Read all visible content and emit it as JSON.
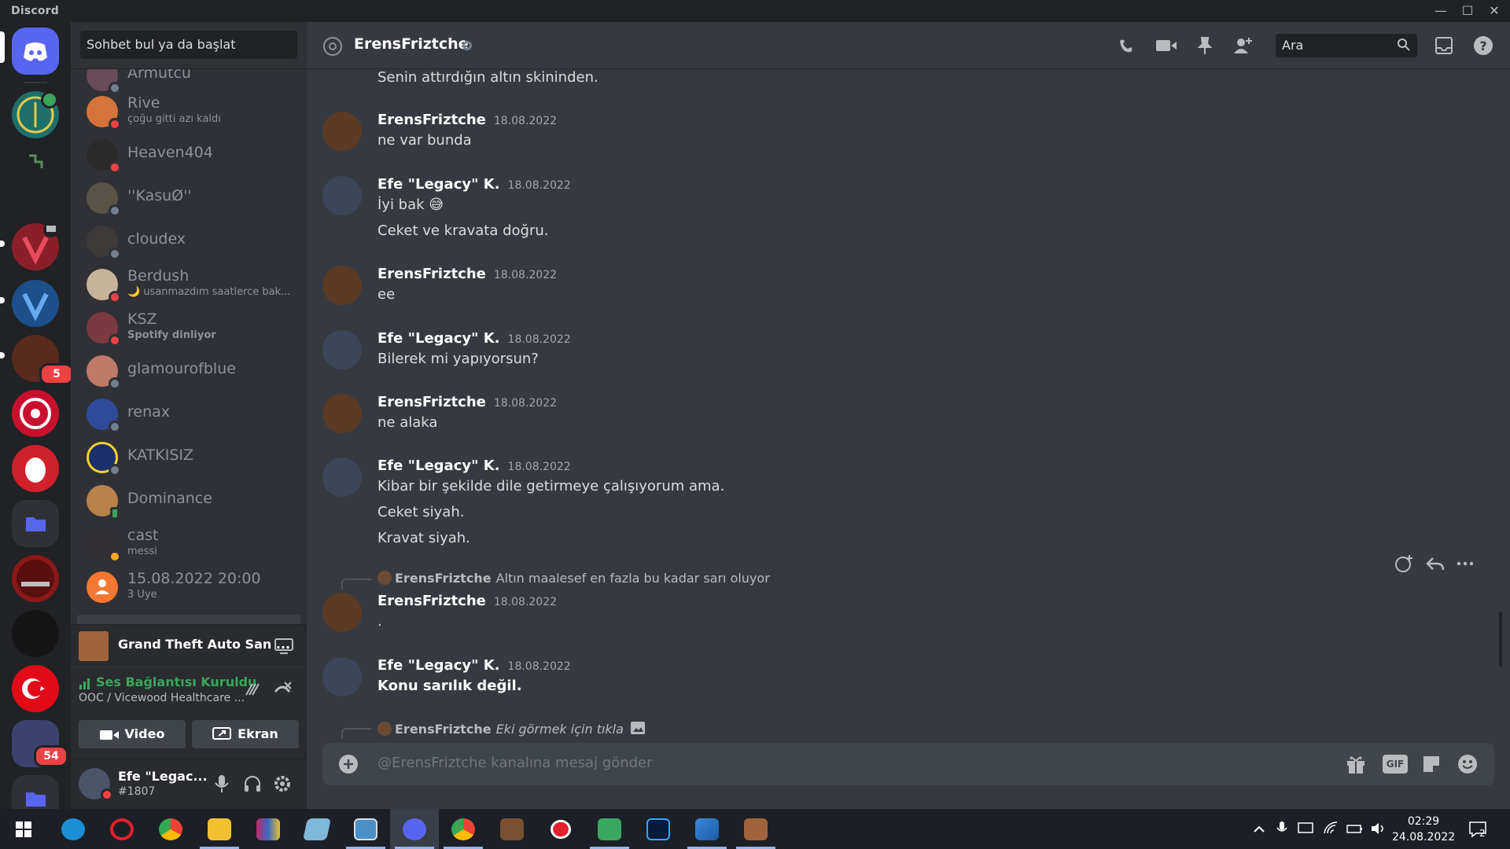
{
  "window": {
    "app_name": "Discord",
    "min": "—",
    "max": "☐",
    "close": "✕"
  },
  "servers": {
    "badge_a": "5",
    "badge_b": "54"
  },
  "dm": {
    "search_placeholder": "Sohbet bul ya da başlat",
    "items": [
      {
        "name": "Armutcu",
        "sub": ""
      },
      {
        "name": "Rive",
        "sub": "çoğu gitti azı kaldı"
      },
      {
        "name": "Heaven404",
        "sub": ""
      },
      {
        "name": "''KasuØ''",
        "sub": ""
      },
      {
        "name": "cloudex",
        "sub": ""
      },
      {
        "name": "Berdush",
        "sub": "🌙 usanmazdım saatlerce bak..."
      },
      {
        "name": "KSZ",
        "sub": "Spotify dinliyor"
      },
      {
        "name": "glamourofblue",
        "sub": ""
      },
      {
        "name": "renax",
        "sub": ""
      },
      {
        "name": "KATKISIZ",
        "sub": ""
      },
      {
        "name": "Dominance",
        "sub": ""
      },
      {
        "name": "cast",
        "sub": "messi"
      },
      {
        "name": "15.08.2022 20:00",
        "sub": "3 Üye"
      }
    ]
  },
  "activity": {
    "game": "Grand Theft Auto San ..."
  },
  "voice": {
    "status": "Ses Bağlantısı Kuruldu",
    "channel": "OOC / Vicewood Healthcare ...",
    "video_label": "Video",
    "screen_label": "Ekran"
  },
  "user": {
    "name": "Efe \"Legac...",
    "tag": "#1807"
  },
  "header": {
    "channel": "ErensFriztche",
    "search_placeholder": "Ara"
  },
  "messages": {
    "top_line": "Senin attırdığın altın skininden.",
    "groups": [
      {
        "author": "ErensFriztche",
        "time": "18.08.2022",
        "lines": [
          "ne var bunda"
        ]
      },
      {
        "author": "Efe \"Legacy\" K.",
        "time": "18.08.2022",
        "lines": [
          "İyi bak 😅",
          "Ceket ve kravata doğru."
        ]
      },
      {
        "author": "ErensFriztche",
        "time": "18.08.2022",
        "lines": [
          "ee"
        ]
      },
      {
        "author": "Efe \"Legacy\" K.",
        "time": "18.08.2022",
        "lines": [
          "Bilerek mi yapıyorsun?"
        ]
      },
      {
        "author": "ErensFriztche",
        "time": "18.08.2022",
        "lines": [
          "ne alaka"
        ]
      },
      {
        "author": "Efe \"Legacy\" K.",
        "time": "18.08.2022",
        "lines": [
          "Kibar bir şekilde dile getirmeye çalışıyorum ama.",
          "Ceket siyah.",
          "Kravat siyah."
        ]
      },
      {
        "author": "ErensFriztche",
        "time": "18.08.2022",
        "lines": [
          "."
        ],
        "reply_name": "ErensFriztche",
        "reply_text": "Altın maalesef en fazla bu kadar sarı oluyor"
      },
      {
        "author": "Efe \"Legacy\" K.",
        "time": "18.08.2022",
        "lines": [
          "Konu sarılık değil."
        ]
      }
    ],
    "last_reply_name": "ErensFriztche",
    "last_reply_text": "Eki görmek için tıkla"
  },
  "composer": {
    "placeholder": "@ErensFriztche kanalına mesaj gönder",
    "gif": "GIF"
  },
  "taskbar": {
    "time": "02:29",
    "date": "24.08.2022",
    "notif": "2"
  },
  "colors": {
    "blurple": "#5865f2",
    "dnd": "#ed4245",
    "online": "#3ba55d",
    "idle": "#faa81a",
    "bg": "#36393f"
  }
}
